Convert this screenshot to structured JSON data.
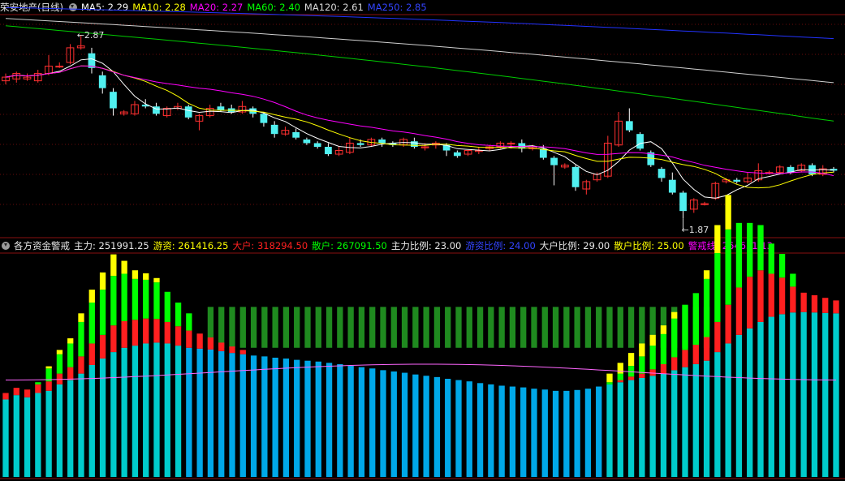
{
  "upper_panel": {
    "stock_title": "荣安地产(日线)",
    "ma_labels": [
      {
        "label": "MA5: 2.29",
        "color": "#ffffff"
      },
      {
        "label": "MA10: 2.28",
        "color": "#ffff00"
      },
      {
        "label": "MA20: 2.27",
        "color": "#ff00ff"
      },
      {
        "label": "MA60: 2.40",
        "color": "#00ff00"
      },
      {
        "label": "MA120: 2.61",
        "color": "#d8d8d8"
      },
      {
        "label": "MA250: 2.85",
        "color": "#3344ff"
      }
    ],
    "dropdown_icon": "circle-dropdown-icon"
  },
  "lower_panel": {
    "indicator_title": "各方资金警戒",
    "labels": [
      {
        "label": "主力: 251991.25",
        "color": "#e8e8e8"
      },
      {
        "label": "游资: 261416.25",
        "color": "#ffff00"
      },
      {
        "label": "大户: 318294.50",
        "color": "#ff2020"
      },
      {
        "label": "散户: 267091.50",
        "color": "#00ff00"
      },
      {
        "label": "主力比例: 23.00",
        "color": "#e8e8e8"
      },
      {
        "label": "游资比例: 24.00",
        "color": "#3344ff"
      },
      {
        "label": "大户比例: 29.00",
        "color": "#e8e8e8"
      },
      {
        "label": "散户比例: 25.00",
        "color": "#ffff00"
      },
      {
        "label": "警戒线: 264631.13",
        "color": "#ff00ff"
      }
    ],
    "dropdown_icon": "circle-dropdown-icon"
  },
  "chart_data": [
    {
      "type": "candlestick",
      "high_marker": "2.87",
      "low_marker": "1.87",
      "ylim": [
        1.8,
        2.95
      ],
      "candles": [
        [
          2.62,
          2.64,
          2.6,
          2.66
        ],
        [
          2.63,
          2.66,
          2.61,
          2.67
        ],
        [
          2.63,
          2.64,
          2.62,
          2.66
        ],
        [
          2.62,
          2.66,
          2.61,
          2.68
        ],
        [
          2.66,
          2.7,
          2.65,
          2.76
        ],
        [
          2.7,
          2.7,
          2.69,
          2.72
        ],
        [
          2.72,
          2.8,
          2.71,
          2.82
        ],
        [
          2.8,
          2.81,
          2.79,
          2.87
        ],
        [
          2.77,
          2.69,
          2.66,
          2.8
        ],
        [
          2.65,
          2.58,
          2.55,
          2.67
        ],
        [
          2.56,
          2.47,
          2.43,
          2.58
        ],
        [
          2.44,
          2.45,
          2.43,
          2.46
        ],
        [
          2.44,
          2.49,
          2.43,
          2.51
        ],
        [
          2.49,
          2.48,
          2.47,
          2.52
        ],
        [
          2.48,
          2.44,
          2.43,
          2.5
        ],
        [
          2.43,
          2.47,
          2.42,
          2.48
        ],
        [
          2.47,
          2.48,
          2.46,
          2.5
        ],
        [
          2.48,
          2.42,
          2.41,
          2.49
        ],
        [
          2.4,
          2.43,
          2.35,
          2.44
        ],
        [
          2.43,
          2.47,
          2.42,
          2.49
        ],
        [
          2.48,
          2.46,
          2.45,
          2.5
        ],
        [
          2.47,
          2.45,
          2.44,
          2.49
        ],
        [
          2.45,
          2.48,
          2.44,
          2.51
        ],
        [
          2.47,
          2.44,
          2.42,
          2.48
        ],
        [
          2.44,
          2.39,
          2.37,
          2.45
        ],
        [
          2.38,
          2.33,
          2.31,
          2.4
        ],
        [
          2.33,
          2.35,
          2.32,
          2.37
        ],
        [
          2.34,
          2.31,
          2.3,
          2.36
        ],
        [
          2.3,
          2.28,
          2.27,
          2.31
        ],
        [
          2.28,
          2.26,
          2.25,
          2.29
        ],
        [
          2.26,
          2.22,
          2.21,
          2.28
        ],
        [
          2.22,
          2.24,
          2.21,
          2.26
        ],
        [
          2.23,
          2.28,
          2.22,
          2.31
        ],
        [
          2.28,
          2.27,
          2.26,
          2.3
        ],
        [
          2.27,
          2.3,
          2.26,
          2.31
        ],
        [
          2.3,
          2.28,
          2.26,
          2.31
        ],
        [
          2.28,
          2.27,
          2.26,
          2.29
        ],
        [
          2.27,
          2.3,
          2.26,
          2.31
        ],
        [
          2.29,
          2.26,
          2.25,
          2.31
        ],
        [
          2.26,
          2.26,
          2.24,
          2.28
        ],
        [
          2.27,
          2.28,
          2.25,
          2.29
        ],
        [
          2.27,
          2.24,
          2.21,
          2.28
        ],
        [
          2.23,
          2.21,
          2.2,
          2.24
        ],
        [
          2.22,
          2.24,
          2.21,
          2.24
        ],
        [
          2.24,
          2.24,
          2.22,
          2.26
        ],
        [
          2.25,
          2.26,
          2.24,
          2.27
        ],
        [
          2.26,
          2.28,
          2.25,
          2.29
        ],
        [
          2.28,
          2.28,
          2.25,
          2.29
        ],
        [
          2.28,
          2.25,
          2.23,
          2.3
        ],
        [
          2.25,
          2.26,
          2.24,
          2.27
        ],
        [
          2.25,
          2.2,
          2.19,
          2.27
        ],
        [
          2.2,
          2.16,
          2.05,
          2.21
        ],
        [
          2.15,
          2.16,
          2.14,
          2.17
        ],
        [
          2.15,
          2.04,
          2.02,
          2.16
        ],
        [
          2.03,
          2.07,
          2.0,
          2.08
        ],
        [
          2.08,
          2.11,
          2.07,
          2.12
        ],
        [
          2.1,
          2.28,
          2.09,
          2.32
        ],
        [
          2.27,
          2.4,
          2.26,
          2.45
        ],
        [
          2.4,
          2.35,
          2.34,
          2.47
        ],
        [
          2.33,
          2.25,
          2.24,
          2.34
        ],
        [
          2.23,
          2.16,
          2.15,
          2.24
        ],
        [
          2.14,
          2.09,
          2.07,
          2.15
        ],
        [
          2.08,
          2.01,
          2.0,
          2.12
        ],
        [
          2.01,
          1.91,
          1.87,
          2.02
        ],
        [
          1.92,
          1.97,
          1.9,
          1.98
        ],
        [
          1.95,
          1.95,
          1.94,
          1.96
        ],
        [
          1.98,
          2.06,
          1.97,
          2.07
        ],
        [
          2.07,
          2.08,
          2.06,
          2.09
        ],
        [
          2.08,
          2.07,
          2.06,
          2.09
        ],
        [
          2.07,
          2.09,
          2.06,
          2.12
        ],
        [
          2.08,
          2.13,
          2.07,
          2.17
        ],
        [
          2.12,
          2.12,
          2.11,
          2.13
        ],
        [
          2.12,
          2.15,
          2.11,
          2.16
        ],
        [
          2.15,
          2.12,
          2.11,
          2.16
        ],
        [
          2.13,
          2.16,
          2.12,
          2.17
        ],
        [
          2.16,
          2.11,
          2.1,
          2.17
        ],
        [
          2.11,
          2.14,
          2.1,
          2.16
        ],
        [
          2.14,
          2.13,
          2.12,
          2.15
        ]
      ],
      "candle_format": "[open, close, low, high]"
    },
    {
      "type": "stacked-bar",
      "series_order": [
        "主力",
        "大户",
        "散户",
        "游资"
      ],
      "colors": {
        "main": "#00cccc",
        "main_hi": "#00a8e8",
        "big": "#ff2020",
        "retail": "#00ff00",
        "hot": "#ffff00",
        "dark": "#1f8a1f",
        "warn": "#ff66ff"
      },
      "ylim": [
        0,
        520000
      ],
      "warning_line": 264631.13,
      "totals_note": "bars drawn from component values",
      "bars": [
        [
          180000,
          15000,
          0,
          0,
          false
        ],
        [
          190000,
          17000,
          0,
          0,
          false
        ],
        [
          185000,
          18000,
          0,
          0,
          false
        ],
        [
          195000,
          20000,
          5000,
          0,
          false
        ],
        [
          200000,
          22000,
          30000,
          5000,
          false
        ],
        [
          215000,
          25000,
          45000,
          10000,
          false
        ],
        [
          225000,
          30000,
          55000,
          12000,
          false
        ],
        [
          240000,
          40000,
          80000,
          20000,
          false
        ],
        [
          260000,
          50000,
          95000,
          30000,
          false
        ],
        [
          275000,
          55000,
          105000,
          40000,
          false
        ],
        [
          290000,
          62000,
          115000,
          50000,
          false
        ],
        [
          300000,
          62000,
          110000,
          30000,
          false
        ],
        [
          305000,
          60000,
          95000,
          20000,
          false
        ],
        [
          310000,
          58000,
          90000,
          15000,
          false
        ],
        [
          312000,
          55000,
          85000,
          10000,
          false
        ],
        [
          310000,
          50000,
          70000,
          0,
          false
        ],
        [
          305000,
          45000,
          55000,
          0,
          false
        ],
        [
          300000,
          40000,
          40000,
          0,
          false
        ],
        [
          298000,
          35000,
          0,
          0,
          false
        ],
        [
          296000,
          28000,
          0,
          0,
          true
        ],
        [
          292000,
          20000,
          0,
          0,
          true
        ],
        [
          288000,
          15000,
          0,
          0,
          true
        ],
        [
          285000,
          10000,
          0,
          0,
          true
        ],
        [
          282000,
          0,
          0,
          0,
          true
        ],
        [
          280000,
          0,
          0,
          0,
          true
        ],
        [
          277000,
          0,
          0,
          0,
          true
        ],
        [
          275000,
          0,
          0,
          0,
          true
        ],
        [
          272000,
          0,
          0,
          0,
          true
        ],
        [
          270000,
          0,
          0,
          0,
          true
        ],
        [
          268000,
          0,
          0,
          0,
          true
        ],
        [
          265000,
          0,
          0,
          0,
          true
        ],
        [
          262000,
          0,
          0,
          0,
          true
        ],
        [
          258000,
          0,
          0,
          0,
          true
        ],
        [
          255000,
          0,
          0,
          0,
          true
        ],
        [
          252000,
          0,
          0,
          0,
          true
        ],
        [
          248000,
          0,
          0,
          0,
          true
        ],
        [
          245000,
          0,
          0,
          0,
          true
        ],
        [
          242000,
          0,
          0,
          0,
          true
        ],
        [
          238000,
          0,
          0,
          0,
          true
        ],
        [
          235000,
          0,
          0,
          0,
          true
        ],
        [
          232000,
          0,
          0,
          0,
          true
        ],
        [
          228000,
          0,
          0,
          0,
          true
        ],
        [
          225000,
          0,
          0,
          0,
          true
        ],
        [
          222000,
          0,
          0,
          0,
          true
        ],
        [
          218000,
          0,
          0,
          0,
          true
        ],
        [
          215000,
          0,
          0,
          0,
          true
        ],
        [
          212000,
          0,
          0,
          0,
          true
        ],
        [
          210000,
          0,
          0,
          0,
          true
        ],
        [
          208000,
          0,
          0,
          0,
          true
        ],
        [
          205000,
          0,
          0,
          0,
          true
        ],
        [
          203000,
          0,
          0,
          0,
          true
        ],
        [
          200000,
          0,
          0,
          0,
          true
        ],
        [
          200000,
          0,
          0,
          0,
          true
        ],
        [
          202000,
          0,
          0,
          0,
          true
        ],
        [
          205000,
          0,
          0,
          0,
          true
        ],
        [
          210000,
          0,
          0,
          0,
          true
        ],
        [
          215000,
          0,
          5000,
          20000,
          true
        ],
        [
          220000,
          5000,
          15000,
          25000,
          true
        ],
        [
          225000,
          8000,
          25000,
          30000,
          true
        ],
        [
          230000,
          10000,
          40000,
          30000,
          true
        ],
        [
          235000,
          15000,
          55000,
          25000,
          true
        ],
        [
          240000,
          22000,
          70000,
          20000,
          true
        ],
        [
          248000,
          30000,
          90000,
          15000,
          true
        ],
        [
          255000,
          40000,
          105000,
          0,
          true
        ],
        [
          262000,
          45000,
          120000,
          0,
          true
        ],
        [
          270000,
          55000,
          135000,
          20000,
          true
        ],
        [
          290000,
          70000,
          160000,
          65000,
          false
        ],
        [
          310000,
          90000,
          175000,
          80000,
          false
        ],
        [
          330000,
          110000,
          150000,
          0,
          false
        ],
        [
          345000,
          120000,
          125000,
          0,
          false
        ],
        [
          360000,
          120000,
          105000,
          0,
          false
        ],
        [
          372000,
          100000,
          70000,
          0,
          false
        ],
        [
          378000,
          85000,
          55000,
          0,
          false
        ],
        [
          382000,
          60000,
          30000,
          0,
          false
        ],
        [
          383000,
          45000,
          0,
          0,
          false
        ],
        [
          382000,
          40000,
          0,
          0,
          false
        ],
        [
          381000,
          35000,
          0,
          0,
          false
        ],
        [
          380000,
          30000,
          0,
          0,
          false
        ]
      ],
      "bar_format": "[主力/base, 大户, 散户, 游资, dark_band]"
    }
  ]
}
